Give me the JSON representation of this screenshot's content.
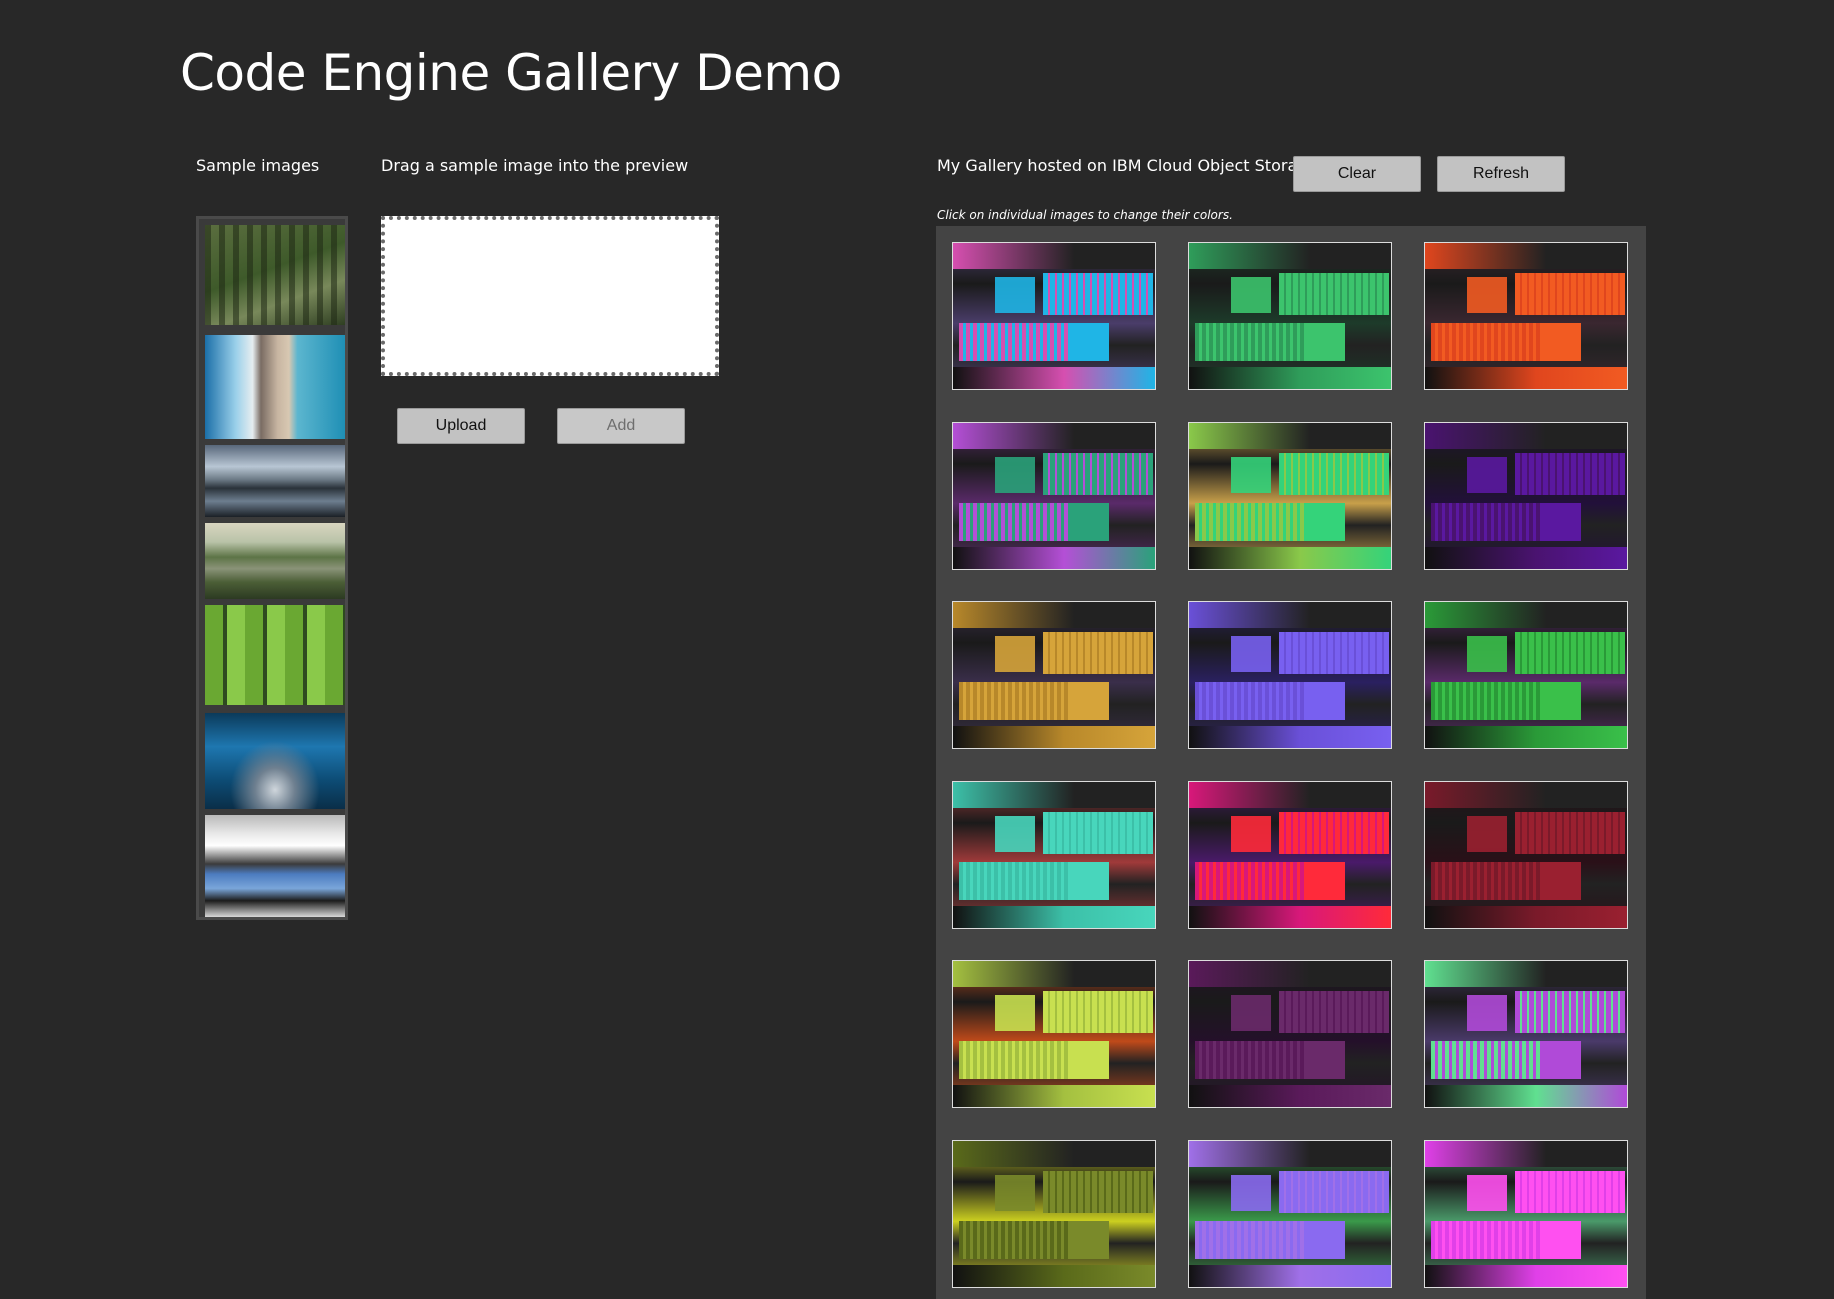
{
  "header": {
    "title": "Code Engine Gallery Demo"
  },
  "samples": {
    "label": "Sample images",
    "images": [
      {
        "name": "aerial-farm-sample"
      },
      {
        "name": "coast-beach-sample"
      },
      {
        "name": "mountain-lake-sample"
      },
      {
        "name": "forest-river-sample"
      },
      {
        "name": "green-field-sample"
      },
      {
        "name": "ice-cave-sample"
      },
      {
        "name": "trucks-sample"
      }
    ]
  },
  "preview": {
    "label": "Drag a sample image into the preview",
    "upload_label": "Upload",
    "add_label": "Add"
  },
  "gallery": {
    "label": "My Gallery hosted on IBM Cloud Object Storage",
    "clear_label": "Clear",
    "refresh_label": "Refresh",
    "hint": "Click on individual images to change their colors.",
    "tints": [
      [
        "#d64fb0",
        "#1fb5e6",
        "#4a3d6a"
      ],
      [
        "#2f9d5a",
        "#3cc46d",
        "#1d3b2a"
      ],
      [
        "#e0461e",
        "#f25b22",
        "#3a2730"
      ],
      [
        "#b44fd6",
        "#2aa27a",
        "#5a2a6a"
      ],
      [
        "#8ac94a",
        "#34d37a",
        "#c8a04a"
      ],
      [
        "#4a1370",
        "#5a18a0",
        "#22103a"
      ],
      [
        "#b8882a",
        "#d6a43a",
        "#3a2e4a"
      ],
      [
        "#6a50d8",
        "#7860f0",
        "#2a2060"
      ],
      [
        "#2a9a38",
        "#3ac04a",
        "#5a2a6a"
      ],
      [
        "#3cc0a8",
        "#48d6bc",
        "#a03a3a"
      ],
      [
        "#d8187a",
        "#ff2a3a",
        "#4a1a6a"
      ],
      [
        "#7a1a2a",
        "#9a2030",
        "#2a1018"
      ],
      [
        "#a4c040",
        "#c8e050",
        "#c04a1a"
      ],
      [
        "#5a1a5a",
        "#6a2a6a",
        "#24102a"
      ],
      [
        "#60e090",
        "#b04ad8",
        "#4a3a6a"
      ],
      [
        "#5a6a1a",
        "#7a8a2a",
        "#ccd020"
      ],
      [
        "#a070e8",
        "#8a6af0",
        "#3a9a4a"
      ],
      [
        "#e040e8",
        "#ff50f0",
        "#4a9a6a"
      ]
    ]
  }
}
